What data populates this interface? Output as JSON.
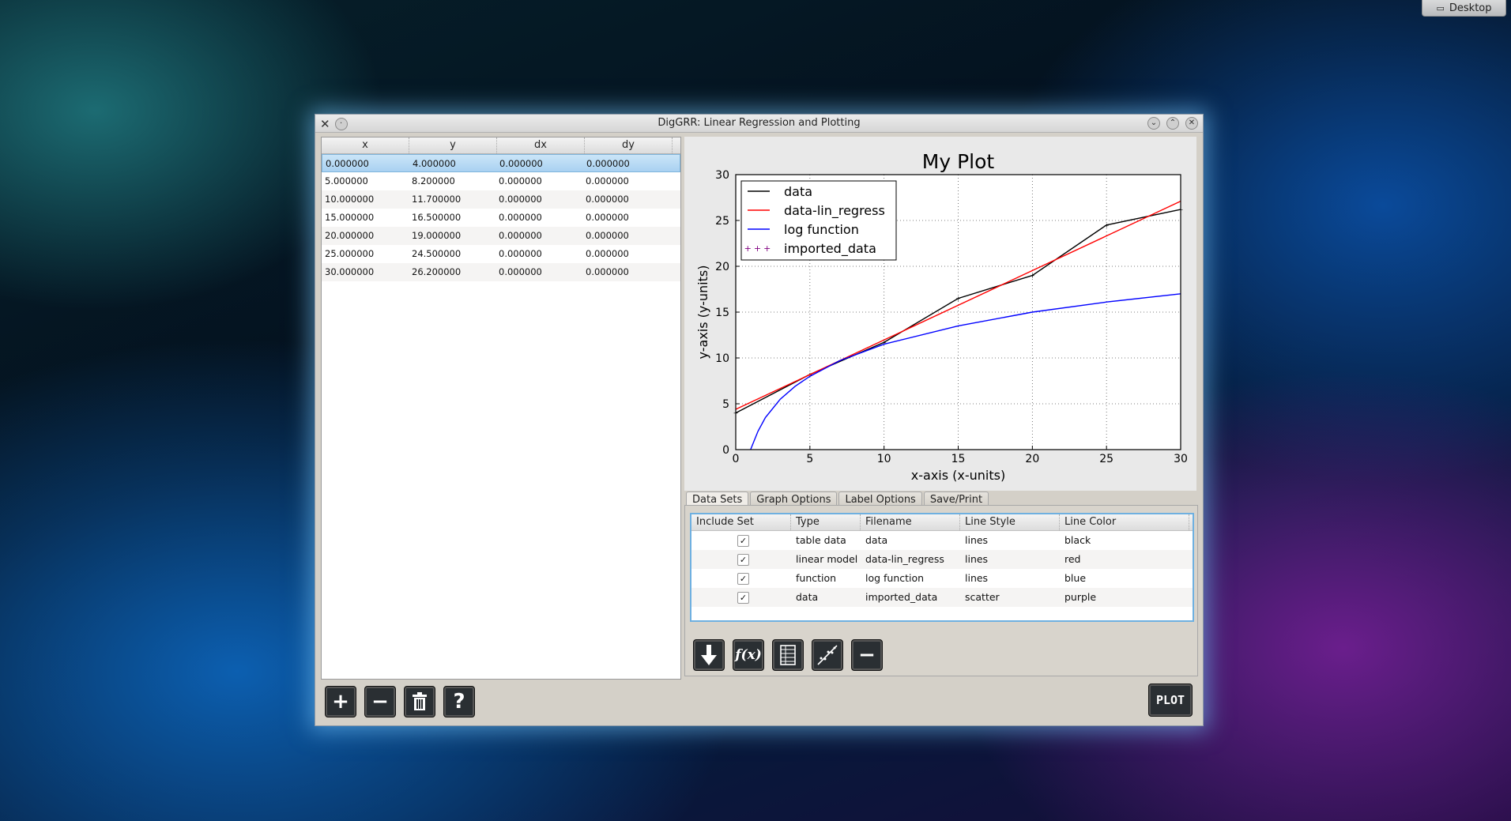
{
  "desktop": {
    "label": "Desktop"
  },
  "window": {
    "title": "DigGRR: Linear Regression and Plotting"
  },
  "table": {
    "headers": [
      "x",
      "y",
      "dx",
      "dy"
    ],
    "rows": [
      [
        "0.000000",
        "4.000000",
        "0.000000",
        "0.000000"
      ],
      [
        "5.000000",
        "8.200000",
        "0.000000",
        "0.000000"
      ],
      [
        "10.000000",
        "11.700000",
        "0.000000",
        "0.000000"
      ],
      [
        "15.000000",
        "16.500000",
        "0.000000",
        "0.000000"
      ],
      [
        "20.000000",
        "19.000000",
        "0.000000",
        "0.000000"
      ],
      [
        "25.000000",
        "24.500000",
        "0.000000",
        "0.000000"
      ],
      [
        "30.000000",
        "26.200000",
        "0.000000",
        "0.000000"
      ]
    ]
  },
  "tabs": [
    "Data Sets",
    "Graph Options",
    "Label Options",
    "Save/Print"
  ],
  "datasets": {
    "headers": [
      "Include Set",
      "Type",
      "Filename",
      "Line Style",
      "Line Color"
    ],
    "rows": [
      {
        "check": "✓",
        "type": "table data",
        "file": "data",
        "style": "lines",
        "color": "black"
      },
      {
        "check": "✓",
        "type": "linear model",
        "file": "data-lin_regress",
        "style": "lines",
        "color": "red"
      },
      {
        "check": "✓",
        "type": "function",
        "file": "log function",
        "style": "lines",
        "color": "blue"
      },
      {
        "check": "✓",
        "type": "data",
        "file": "imported_data",
        "style": "scatter",
        "color": "purple"
      }
    ]
  },
  "buttons": {
    "add": "+",
    "remove": "−",
    "help": "?",
    "plot": "PLOT"
  },
  "chart_data": {
    "type": "line",
    "title": "My Plot",
    "xlabel": "x-axis (x-units)",
    "ylabel": "y-axis (y-units)",
    "xlim": [
      0,
      30
    ],
    "ylim": [
      0,
      30
    ],
    "xticks": [
      0,
      5,
      10,
      15,
      20,
      25,
      30
    ],
    "yticks": [
      0,
      5,
      10,
      15,
      20,
      25,
      30
    ],
    "grid": true,
    "legend_position": "top-left",
    "series": [
      {
        "name": "data",
        "color": "#000000",
        "style": "line",
        "x": [
          0,
          5,
          10,
          15,
          20,
          25,
          30
        ],
        "y": [
          4.0,
          8.2,
          11.7,
          16.5,
          19.0,
          24.5,
          26.2
        ]
      },
      {
        "name": "data-lin_regress",
        "color": "#ff0000",
        "style": "line",
        "x": [
          0,
          30
        ],
        "y": [
          4.4,
          27.1
        ]
      },
      {
        "name": "log function",
        "color": "#0000ff",
        "style": "line",
        "x": [
          1,
          1.5,
          2,
          3,
          4,
          5,
          7,
          10,
          15,
          20,
          25,
          30
        ],
        "y": [
          0,
          2.0,
          3.5,
          5.5,
          6.9,
          8.0,
          9.7,
          11.5,
          13.5,
          15.0,
          16.1,
          17.0
        ]
      },
      {
        "name": "imported_data",
        "color": "#800080",
        "style": "scatter",
        "x": [],
        "y": []
      }
    ]
  }
}
